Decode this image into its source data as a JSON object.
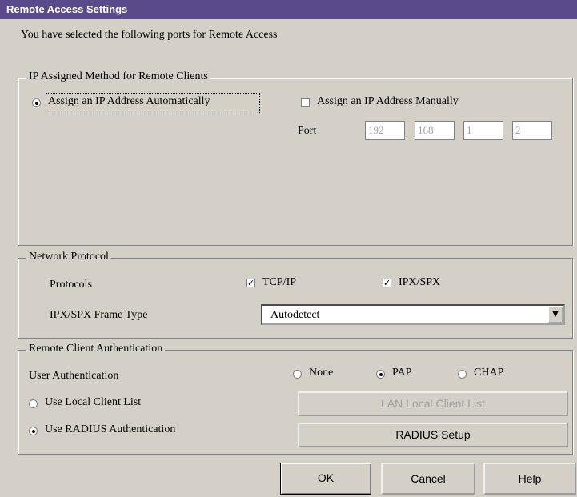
{
  "window": {
    "title": "Remote Access Settings"
  },
  "intro": "You have selected the following ports for Remote Access",
  "ip_group": {
    "title": "IP Assigned Method for Remote Clients",
    "auto_label": "Assign an IP Address Automatically",
    "manual_label": "Assign an IP Address Manually",
    "port_label": "Port",
    "octets": [
      "192",
      "168",
      "1",
      "2"
    ],
    "selected": "auto"
  },
  "network_group": {
    "title": "Network Protocol",
    "protocols_label": "Protocols",
    "tcpip_label": "TCP/IP",
    "tcpip_checked": true,
    "ipxspx_label": "IPX/SPX",
    "ipxspx_checked": true,
    "frame_type_label": "IPX/SPX Frame Type",
    "frame_type_value": "Autodetect"
  },
  "auth_group": {
    "title": "Remote Client Authentication",
    "user_auth_label": "User Authentication",
    "none_label": "None",
    "pap_label": "PAP",
    "chap_label": "CHAP",
    "selected_method": "PAP",
    "local_list_label": "Use Local Client List",
    "radius_label": "Use RADIUS Authentication",
    "selected_source": "radius",
    "local_list_button": "LAN Local Client List",
    "radius_setup_button": "RADIUS Setup"
  },
  "buttons": {
    "ok": "OK",
    "cancel": "Cancel",
    "help": "Help"
  },
  "colors": {
    "titlebar": "#5b4a8b",
    "face": "#d4d0c8"
  }
}
